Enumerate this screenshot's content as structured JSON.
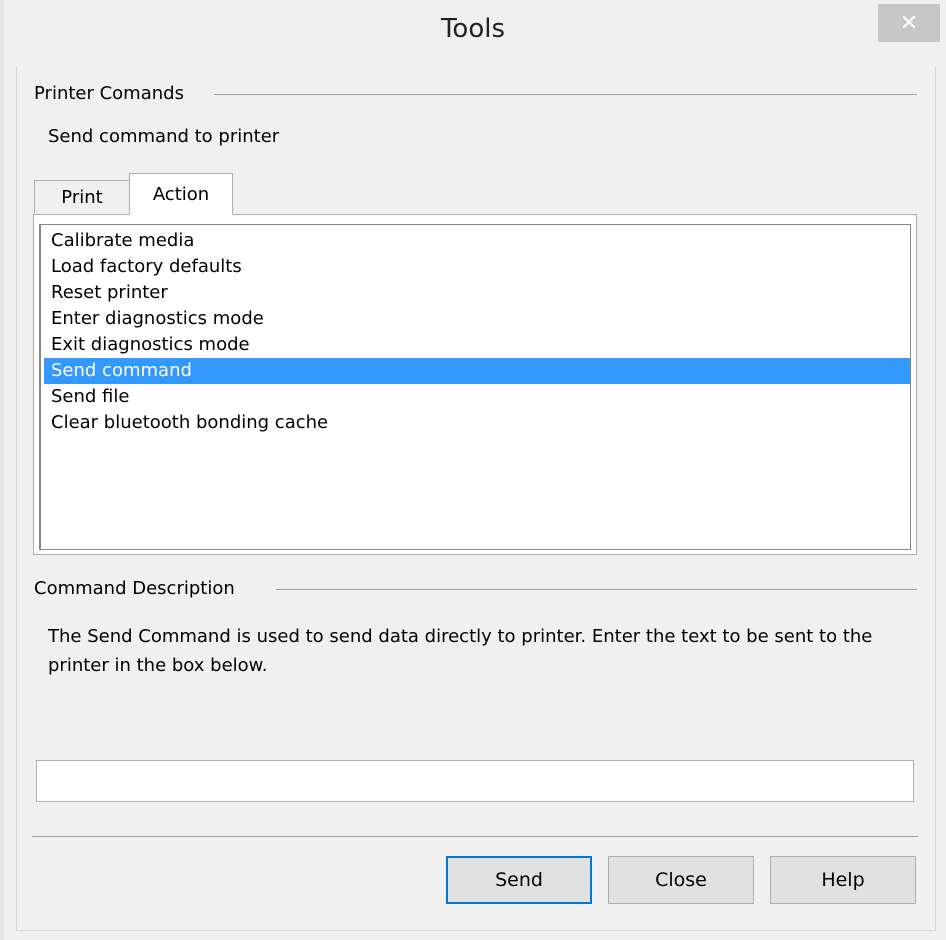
{
  "window": {
    "title": "Tools",
    "close_glyph": "✕"
  },
  "printer_group": {
    "title": "Printer Comands",
    "subtitle": "Send command to printer"
  },
  "tabs": [
    {
      "label": "Print",
      "active": false
    },
    {
      "label": "Action",
      "active": true
    }
  ],
  "actions": {
    "items": [
      "Calibrate media",
      "Load factory defaults",
      "Reset printer",
      "Enter diagnostics mode",
      "Exit diagnostics mode",
      "Send command",
      "Send file",
      "Clear bluetooth bonding cache"
    ],
    "selected_index": 5
  },
  "description_group": {
    "title": "Command Description",
    "text": "The Send Command is used to send data directly to printer. Enter the text to be sent to the printer in the box below."
  },
  "command_input": {
    "value": ""
  },
  "buttons": {
    "send": "Send",
    "close": "Close",
    "help": "Help"
  },
  "colors": {
    "selection": "#3399ff",
    "default_button_border": "#0078d7"
  }
}
